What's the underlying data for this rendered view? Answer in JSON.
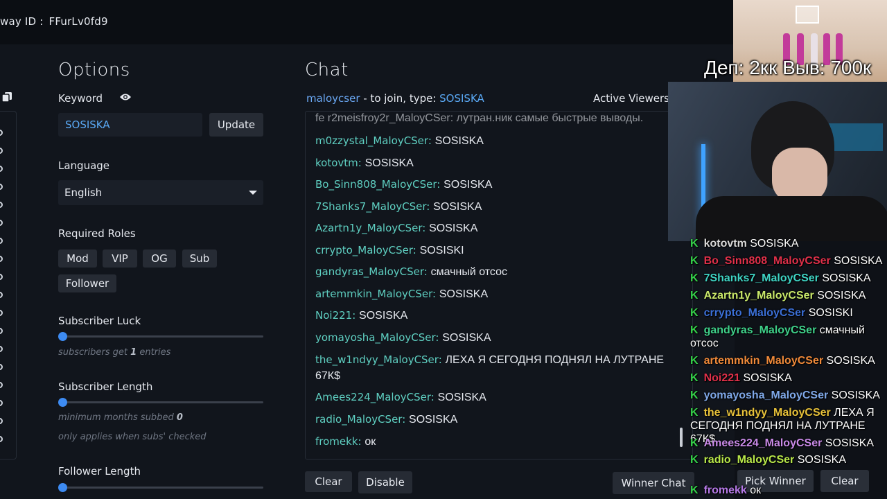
{
  "header": {
    "giveaway_label": "way ID :",
    "giveaway_id": "FFurLv0fd9"
  },
  "options": {
    "title": "Options",
    "keyword_label": "Keyword",
    "keyword_value": "SOSISKA",
    "update_label": "Update",
    "language_label": "Language",
    "language_value": "English",
    "roles_label": "Required Roles",
    "roles": [
      "Mod",
      "VIP",
      "OG",
      "Sub",
      "Follower"
    ],
    "sub_luck_label": "Subscriber Luck",
    "sub_luck_hint_pre": "subscribers get",
    "sub_luck_value": "1",
    "sub_luck_hint_post": "entries",
    "sub_length_label": "Subscriber Length",
    "sub_length_hint_pre": "minimum months subbed",
    "sub_length_value": "0",
    "sub_length_note": "only applies when subs' checked",
    "follower_length_label": "Follower Length",
    "clear_label": "Clear",
    "disable_label": "Disable"
  },
  "chat": {
    "title": "Chat",
    "channel": "maloycser",
    "join_text": " - to join, type: ",
    "join_keyword": "SOSISKA",
    "active_viewers_label": "Active Viewers",
    "winner_chat_label": "Winner Chat",
    "partial_top": "fe r2meisfroy2r_MaloyCSer: лутран.ник самые быстрые выводы.",
    "messages": [
      {
        "user": "m0zzystal_MaloyCSer:",
        "text": "SOSISKA"
      },
      {
        "user": "kotovtm:",
        "text": "SOSISKA"
      },
      {
        "user": "Bo_Sinn808_MaloyCSer:",
        "text": "SOSISKA"
      },
      {
        "user": "7Shanks7_MaloyCSer:",
        "text": "SOSISKA"
      },
      {
        "user": "Azartn1y_MaloyCSer:",
        "text": "SOSISKA"
      },
      {
        "user": "crrypto_MaloyCSer:",
        "text": "SOSISKI"
      },
      {
        "user": "gandyras_MaloyCSer:",
        "text": "смачный отсос"
      },
      {
        "user": "artemmkin_MaloyCSer:",
        "text": "SOSISKA"
      },
      {
        "user": "Noi221:",
        "text": "SOSISKA"
      },
      {
        "user": "yomayosha_MaloyCSer:",
        "text": "SOSISKA"
      },
      {
        "user": "the_w1ndyy_MaloyCSer:",
        "text": "ЛЕХА Я СЕГОДНЯ ПОДНЯЛ НА ЛУТРАНЕ 67К$"
      },
      {
        "user": "Amees224_MaloyCSer:",
        "text": "SOSISKA"
      },
      {
        "user": "radio_MaloyCSer:",
        "text": "SOSISKA"
      },
      {
        "user": "fromekk:",
        "text": "ок"
      }
    ]
  },
  "winner": {
    "pick_label": "Pick Winner",
    "clear_label": "Clear"
  },
  "stream": {
    "stats": "Деп: 2кк Выв: 700к",
    "badge_glyph": "K",
    "badge_color": "#35d04a",
    "chat_lines": [
      {
        "user": "kotovtm",
        "color": "#d9d9d9",
        "text": "SOSISKA"
      },
      {
        "user": "Bo_Sinn808_MaloyCSer",
        "color": "#e0304a",
        "text": "SOSISKA"
      },
      {
        "user": "7Shanks7_MaloyCSer",
        "color": "#3fd3c4",
        "text": "SOSISKA"
      },
      {
        "user": "Azartn1y_MaloyCSer",
        "color": "#c9e86a",
        "text": "SOSISKA"
      },
      {
        "user": "crrypto_MaloyCSer",
        "color": "#3b6fd6",
        "text": "SOSISKI"
      },
      {
        "user": "gandyras_MaloyCSer",
        "color": "#3fd08a",
        "text": "смачный отсос"
      },
      {
        "user": "artemmkin_MaloyCSer",
        "color": "#f08a3a",
        "text": "SOSISKA"
      },
      {
        "user": "Noi221",
        "color": "#e0304a",
        "text": "SOSISKA"
      },
      {
        "user": "yomayosha_MaloyCSer",
        "color": "#7fa8e8",
        "text": "SOSISKA"
      },
      {
        "user": "the_w1ndyy_MaloyCSer",
        "color": "#e8c23a",
        "text": "ЛЕХА Я СЕГОДНЯ ПОДНЯЛ НА ЛУТРАНЕ 67К$"
      },
      {
        "user": "Amees224_MaloyCSer",
        "color": "#c98ae8",
        "text": "SOSISKA"
      },
      {
        "user": "radio_MaloyCSer",
        "color": "#b9e84a",
        "text": "SOSISKA"
      },
      {
        "user": "fromekk",
        "color": "#b67ae8",
        "text": "ок"
      }
    ]
  }
}
